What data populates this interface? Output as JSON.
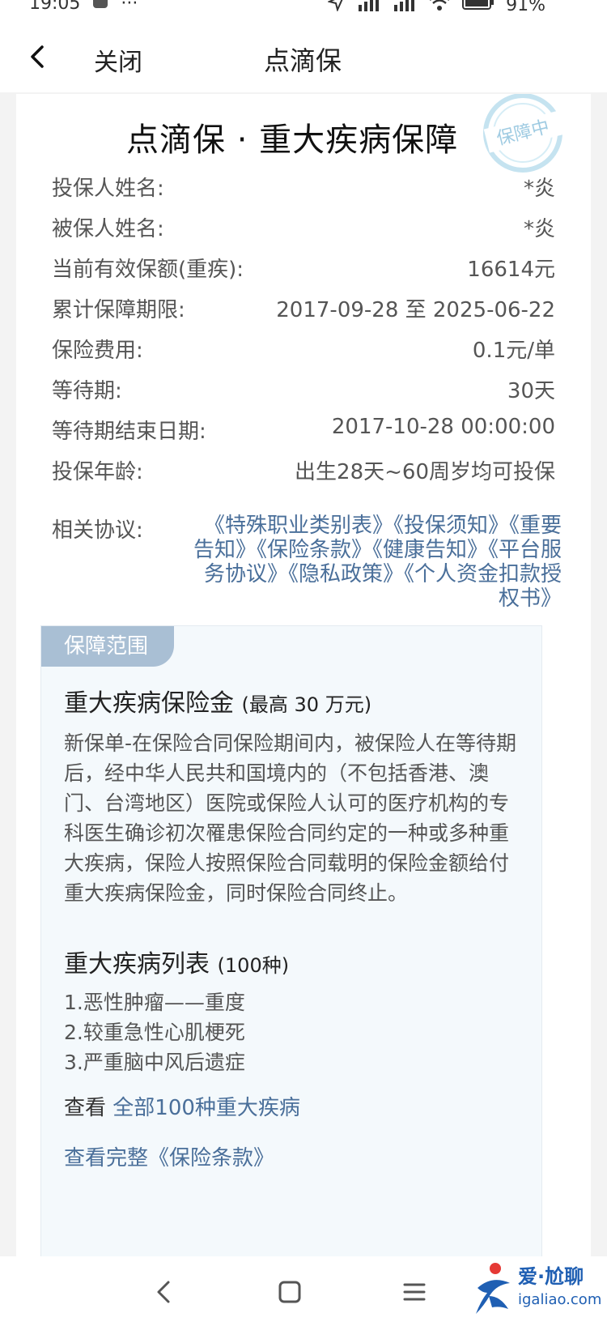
{
  "status_bar": {
    "time": "19:05",
    "battery": "91%"
  },
  "nav": {
    "close_label": "关闭",
    "title": "点滴保"
  },
  "card": {
    "title": "点滴保 · 重大疾病保障",
    "stamp_text": "保障中"
  },
  "info_rows": [
    {
      "label": "投保人姓名:",
      "value": "*炎"
    },
    {
      "label": "被保人姓名:",
      "value": "*炎"
    },
    {
      "label": "当前有效保额(重疾):",
      "value": "16614元"
    },
    {
      "label": "累计保障期限:",
      "value": "2017-09-28 至 2025-06-22"
    },
    {
      "label": "保险费用:",
      "value": "0.1元/单"
    },
    {
      "label": "等待期:",
      "value": "30天"
    },
    {
      "label": "等待期结束日期:",
      "value": "2017-10-28 00:00:00"
    },
    {
      "label": "投保年龄:",
      "value": "出生28天~60周岁均可投保"
    }
  ],
  "protocols": {
    "label": "相关协议:",
    "links": [
      "《特殊职业类别表》",
      "《投保须知》",
      "《重要告知》",
      "《保险条款》",
      "《健康告知》",
      "《平台服务协议》",
      "《隐私政策》",
      "《个人资金扣款授权书》"
    ]
  },
  "coverage": {
    "tab_label": "保障范围",
    "item_title": "重大疾病保险金",
    "item_subtitle": "(最高 30 万元)",
    "item_desc": "新保单-在保险合同保险期间内，被保险人在等待期后，经中华人民共和国境内的（不包括香港、澳门、台湾地区）医院或保险人认可的医疗机构的专科医生确诊初次罹患保险合同约定的一种或多种重大疾病，保险人按照保险合同载明的保险金额给付重大疾病保险金，同时保险合同终止。",
    "list_title": "重大疾病列表",
    "list_count": "(100种)",
    "list_items": [
      "1.恶性肿瘤——重度",
      "2.较重急性心肌梗死",
      "3.严重脑中风后遗症"
    ],
    "view_prefix": "查看",
    "view_all_link": "全部100种重大疾病",
    "view_terms": "查看完整《保险条款》"
  },
  "watermark": {
    "brand": "爱·尬聊",
    "domain": "igaliao.com"
  },
  "colors": {
    "link": "#4a6f9a",
    "tab_bg": "#a9bfd4",
    "box_bg": "#f4f9fc"
  }
}
